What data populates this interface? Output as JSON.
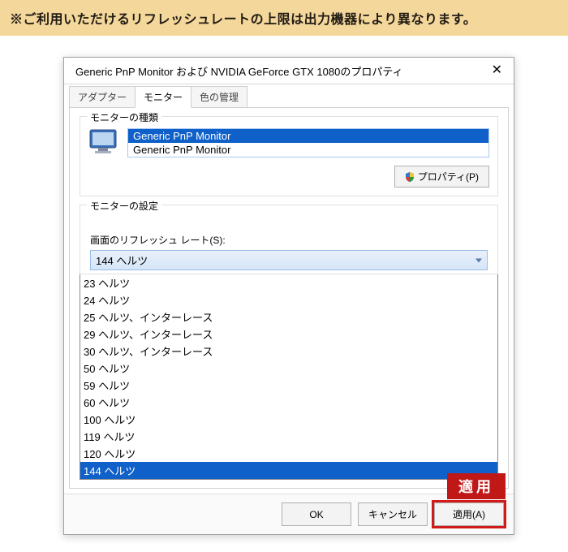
{
  "banner": "※ご利用いただけるリフレッシュレートの上限は出力機器により異なります。",
  "dialog": {
    "title": "Generic PnP Monitor および NVIDIA GeForce GTX 1080のプロパティ"
  },
  "tabs": {
    "adapter": "アダプター",
    "monitor": "モニター",
    "color": "色の管理"
  },
  "monitorType": {
    "group_label": "モニターの種類",
    "items": [
      "Generic PnP Monitor",
      "Generic PnP Monitor"
    ],
    "properties_button": "プロパティ(P)"
  },
  "monitorSettings": {
    "group_label": "モニターの設定",
    "refresh_label": "画面のリフレッシュ レート(S):",
    "selected": "144 ヘルツ",
    "options": [
      "23 ヘルツ",
      "24 ヘルツ",
      "25 ヘルツ、インターレース",
      "29 ヘルツ、インターレース",
      "30 ヘルツ、インターレース",
      "50 ヘルツ",
      "59 ヘルツ",
      "60 ヘルツ",
      "100 ヘルツ",
      "119 ヘルツ",
      "120 ヘルツ",
      "144 ヘルツ"
    ]
  },
  "footer": {
    "ok": "OK",
    "cancel": "キャンセル",
    "apply": "適用(A)"
  },
  "callout": {
    "apply_flag": "適用"
  }
}
